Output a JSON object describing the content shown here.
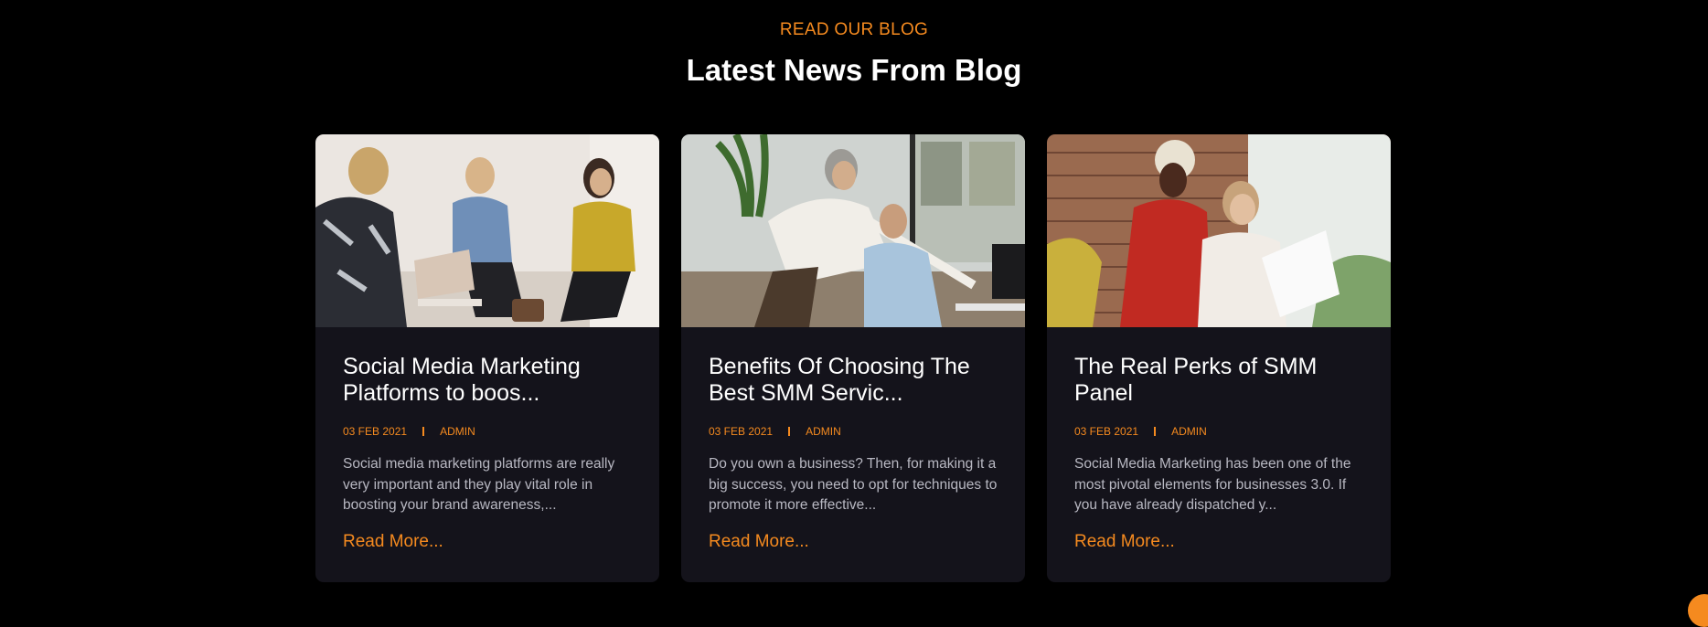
{
  "section": {
    "eyebrow": "READ OUR BLOG",
    "title": "Latest News From Blog"
  },
  "posts": [
    {
      "image_alt": "People in a casual meeting around a laptop",
      "title": "Social Media Marketing Platforms to boos...",
      "date": "03 FEB 2021",
      "author": "ADMIN",
      "excerpt": "Social media marketing platforms are really very important and they play vital role in boosting your brand awareness,...",
      "read_more": "Read More..."
    },
    {
      "image_alt": "Woman pointing at a computer screen beside a colleague",
      "title": "Benefits Of Choosing The Best SMM Servic...",
      "date": "03 FEB 2021",
      "author": "ADMIN",
      "excerpt": "Do you own a business? Then, for making it a big success, you need to opt for techniques to promote it more effective...",
      "read_more": "Read More..."
    },
    {
      "image_alt": "Two women reviewing a document in front of a brick wall",
      "title": "The Real Perks of SMM Panel",
      "date": "03 FEB 2021",
      "author": "ADMIN",
      "excerpt": "Social Media Marketing has been one of the most pivotal elements for businesses 3.0. If you have already dispatched y...",
      "read_more": "Read More..."
    }
  ],
  "colors": {
    "accent": "#f58a1f",
    "card_background": "#14131b",
    "page_background": "#000000"
  }
}
